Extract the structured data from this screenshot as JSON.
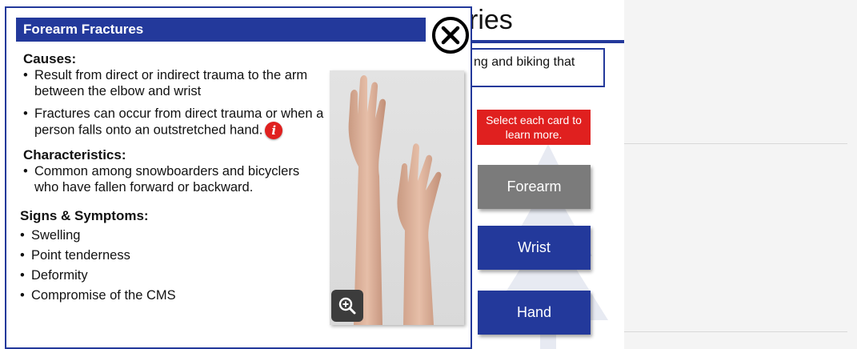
{
  "background": {
    "title": "ries",
    "box_text": "ng and biking that",
    "instruction": "Select each card to learn more.",
    "cards": [
      {
        "label": "Forearm"
      },
      {
        "label": "Wrist"
      },
      {
        "label": "Hand"
      }
    ]
  },
  "popup": {
    "title": "Forearm Fractures",
    "causes": {
      "heading": "Causes:",
      "items": [
        "Result from direct or indirect trauma to the arm between the elbow and wrist",
        "Fractures can occur from direct trauma or when a person falls onto an outstretched hand."
      ]
    },
    "characteristics": {
      "heading": "Characteristics:",
      "items": [
        "Common among snowboarders and bicyclers who have fallen forward or backward."
      ]
    },
    "signs": {
      "heading": "Signs & Symptoms:",
      "items": [
        "Swelling",
        "Point tenderness",
        "Deformity",
        "Compromise of the CMS"
      ]
    },
    "info_glyph": "i"
  },
  "icons": {
    "close": "close-circle-icon",
    "info": "info-icon",
    "zoom": "zoom-in-icon"
  },
  "colors": {
    "brand_blue": "#23399b",
    "alert_red": "#e0201f",
    "card_gray": "#7b7b7b"
  }
}
